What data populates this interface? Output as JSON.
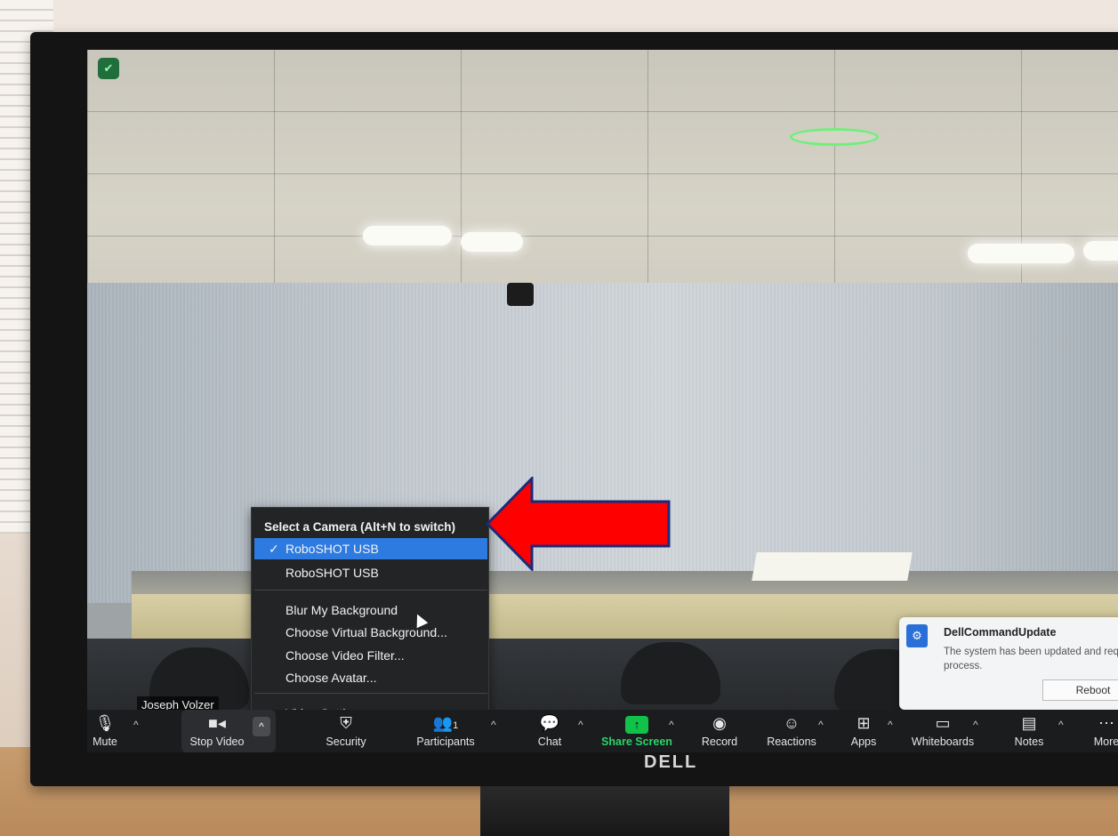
{
  "video": {
    "participant_name": "Joseph Volzer"
  },
  "camera_menu": {
    "title": "Select a Camera (Alt+N to switch)",
    "cameras": [
      {
        "label": "RoboSHOT USB",
        "selected": true,
        "check": "✓"
      },
      {
        "label": "RoboSHOT USB",
        "selected": false
      }
    ],
    "options": [
      "Blur My Background",
      "Choose Virtual Background...",
      "Choose Video Filter...",
      "Choose Avatar..."
    ],
    "settings": "Video Settings..."
  },
  "annotation": {
    "arrow_color": "#ff0000",
    "arrow_border": "#1a2a7a"
  },
  "toast": {
    "title": "DellCommandUpdate",
    "body": "The system has been updated and requires a",
    "body_line2": "process.",
    "button": "Reboot"
  },
  "toolbar": {
    "mute": "Mute",
    "stop_video": "Stop Video",
    "security": "Security",
    "participants": "Participants",
    "participants_count": "1",
    "chat": "Chat",
    "share_screen": "Share Screen",
    "record": "Record",
    "reactions": "Reactions",
    "apps": "Apps",
    "whiteboards": "Whiteboards",
    "notes": "Notes",
    "more": "More",
    "accent_green": "#2bd36a"
  },
  "monitor": {
    "brand": "DELL"
  }
}
